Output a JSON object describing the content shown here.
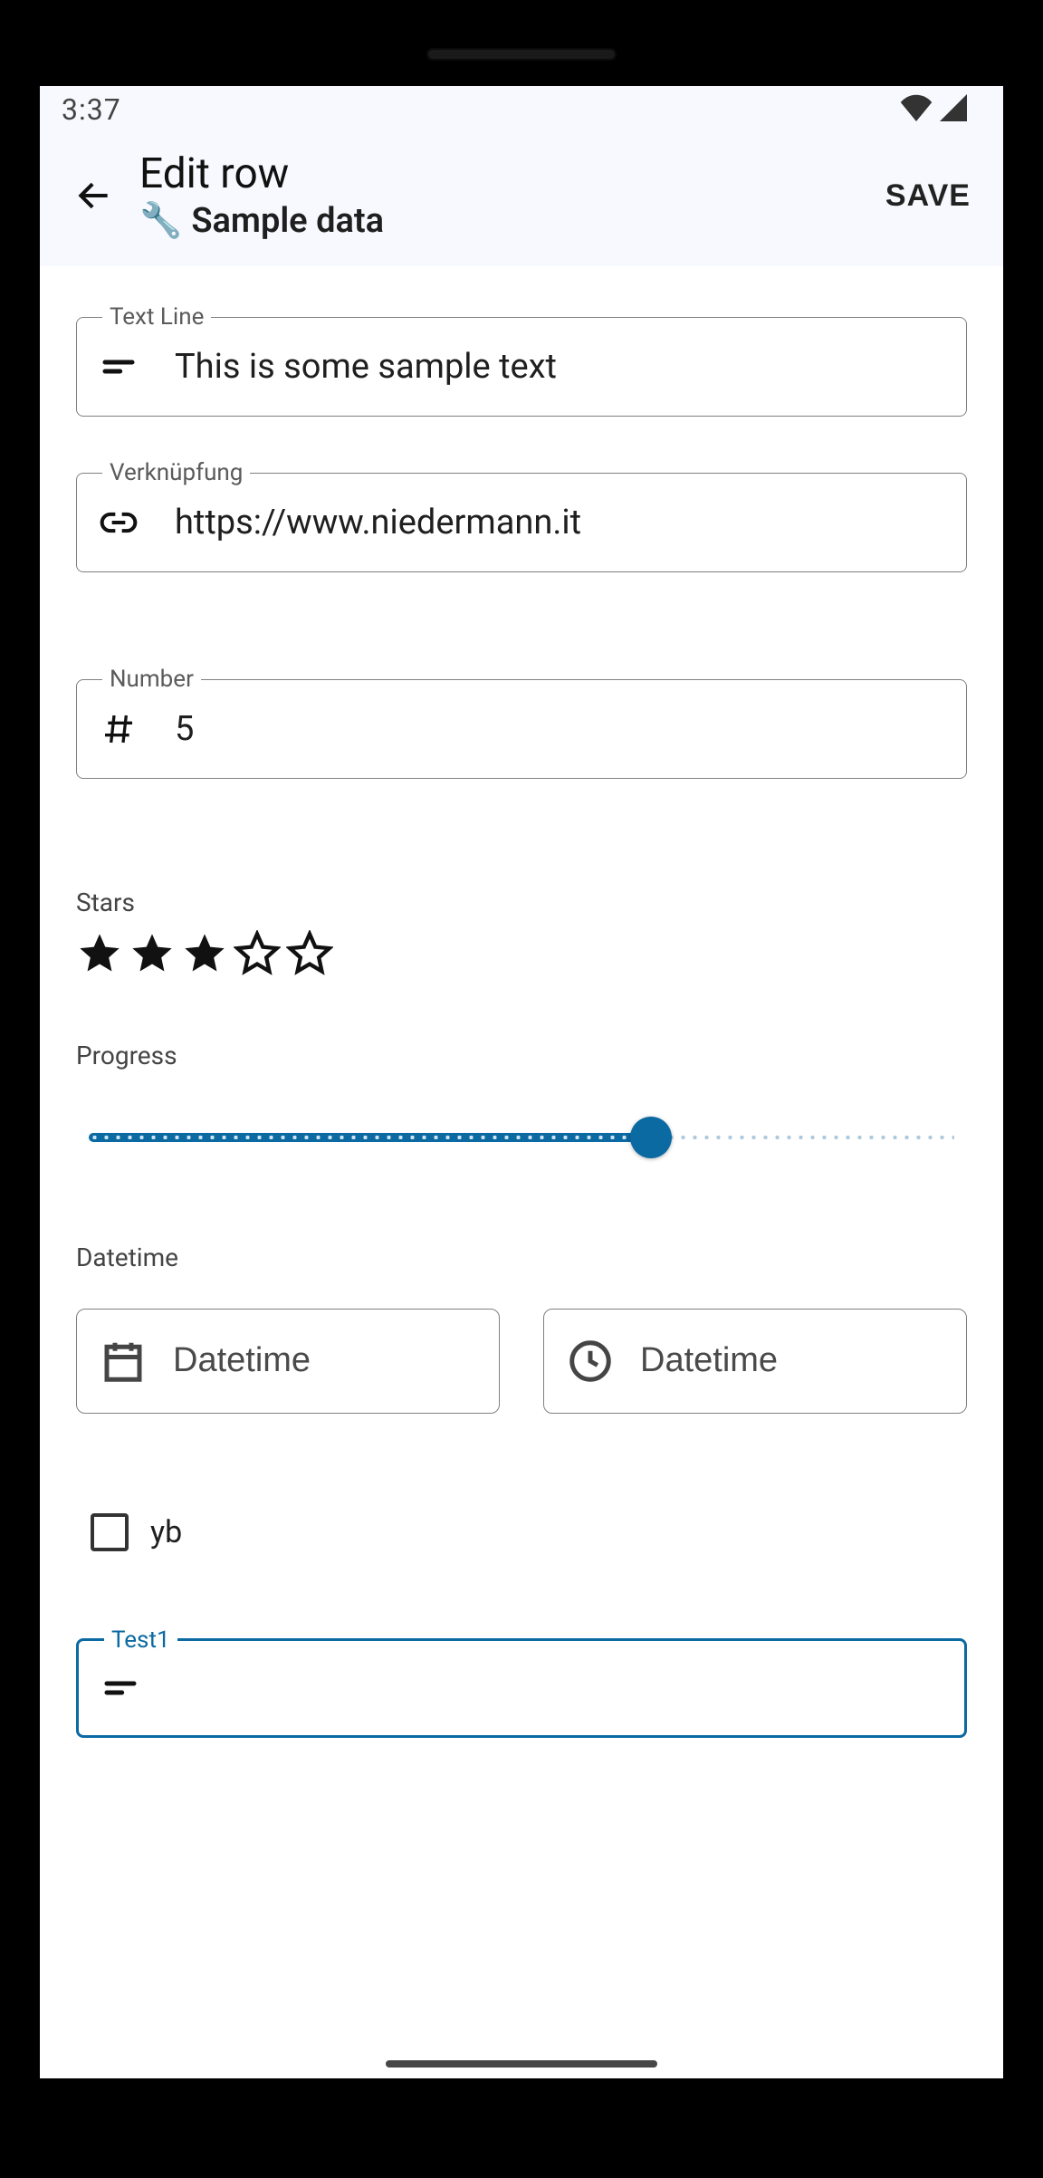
{
  "statusbar": {
    "time": "3:37"
  },
  "appbar": {
    "title": "Edit row",
    "subtitle_icon": "wrench-icon",
    "subtitle": "Sample data",
    "save_label": "SAVE"
  },
  "fields": {
    "text_line": {
      "label": "Text Line",
      "value": "This is some sample text"
    },
    "link": {
      "label": "Verknüpfung",
      "value": "https://www.niedermann.it"
    },
    "number": {
      "label": "Number",
      "value": "5"
    },
    "test1": {
      "label": "Test1",
      "value": ""
    }
  },
  "stars": {
    "label": "Stars",
    "value": 3,
    "max": 5
  },
  "progress": {
    "label": "Progress",
    "value": 65
  },
  "datetime": {
    "label": "Datetime",
    "date_button_label": "Datetime",
    "time_button_label": "Datetime"
  },
  "checkbox": {
    "label": "yb",
    "checked": false
  }
}
